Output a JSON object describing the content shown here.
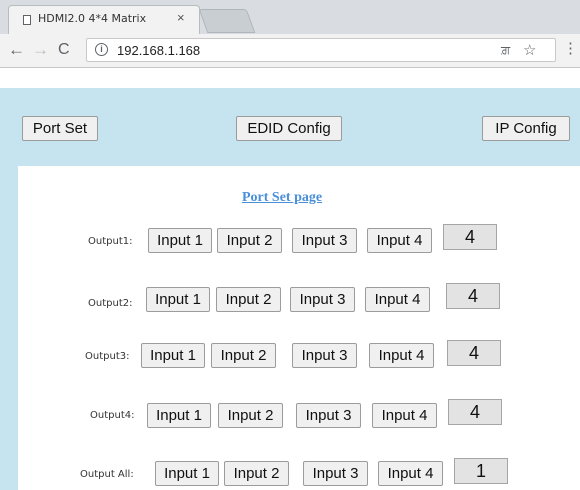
{
  "browser": {
    "tab_title": "HDMI2.0 4*4 Matrix",
    "tab_close": "×",
    "url": "192.168.1.168",
    "back_icon": "←",
    "forward_icon": "→",
    "reload_icon": "C",
    "info_icon": "i",
    "translate_icon": "ਗ਼",
    "star_icon": "☆",
    "menu_icon": "⋮"
  },
  "header": {
    "port_set": "Port Set",
    "edid_config": "EDID Config",
    "ip_config": "IP Config"
  },
  "page": {
    "heading": "Port Set page"
  },
  "rows": [
    {
      "label": "Output1:",
      "inputs": [
        "Input 1",
        "Input 2",
        "Input 3",
        "Input 4"
      ],
      "value": "4"
    },
    {
      "label": "Output2:",
      "inputs": [
        "Input 1",
        "Input 2",
        "Input 3",
        "Input 4"
      ],
      "value": "4"
    },
    {
      "label": "Output3:",
      "inputs": [
        "Input 1",
        "Input 2",
        "Input 3",
        "Input 4"
      ],
      "value": "4"
    },
    {
      "label": "Output4:",
      "inputs": [
        "Input 1",
        "Input 2",
        "Input 3",
        "Input 4"
      ],
      "value": "4"
    },
    {
      "label": "Output All:",
      "inputs": [
        "Input 1",
        "Input 2",
        "Input 3",
        "Input 4"
      ],
      "value": "1"
    }
  ],
  "colors": {
    "header_band": "#c6e4f0",
    "heading_link": "#4a90d9"
  }
}
